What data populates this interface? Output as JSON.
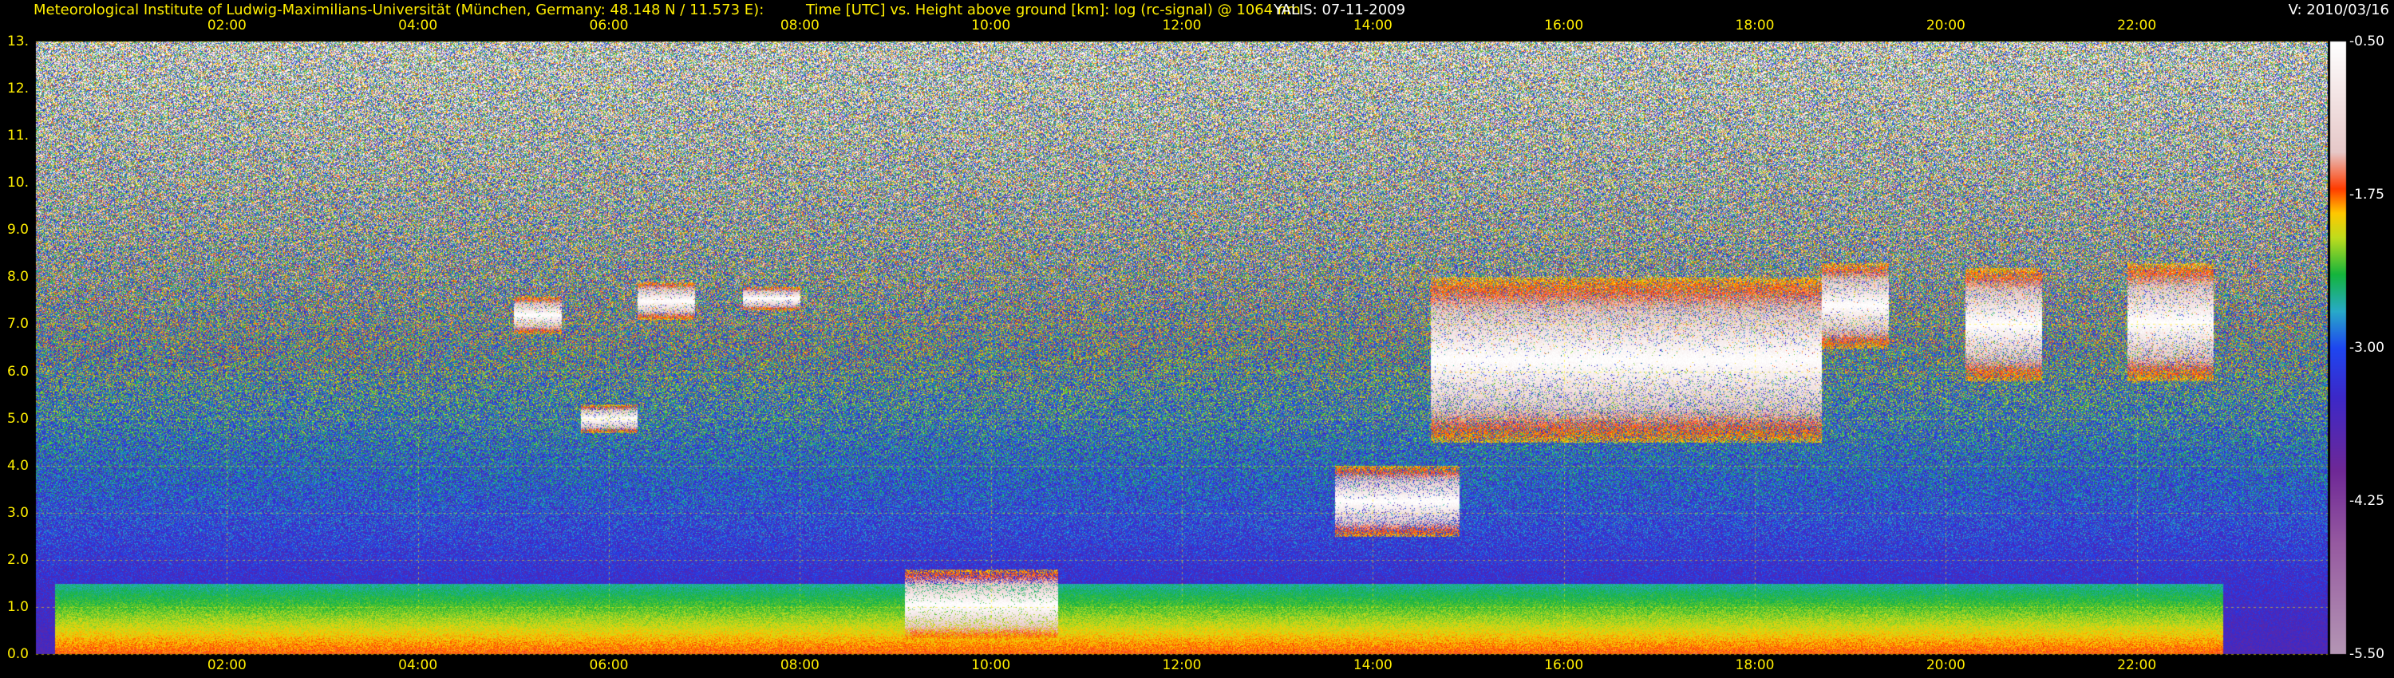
{
  "header": {
    "institute": "Meteorological Institute of Ludwig-Maximilians-Universität (München, Germany: 48.148 N / 11.573 E):",
    "axis_desc": "Time [UTC] vs. Height above ground [km]: log (rc-signal) @ 1064 nm",
    "instrument": "YALIS: 07-11-2009",
    "version": "V: 2010/03/16"
  },
  "colors": {
    "header_text": "#ffee00",
    "grid": "#ffee00",
    "background": "#000000"
  },
  "chart_data": {
    "type": "heatmap",
    "title": "Time [UTC] vs. Height above ground [km]: log (rc-signal) @ 1064 nm",
    "x_ticks": [
      "02:00",
      "04:00",
      "06:00",
      "08:00",
      "10:00",
      "12:00",
      "14:00",
      "16:00",
      "18:00",
      "20:00",
      "22:00"
    ],
    "x_tick_hours": [
      2,
      4,
      6,
      8,
      10,
      12,
      14,
      16,
      18,
      20,
      22
    ],
    "xlim_hours": [
      0.0,
      24.0
    ],
    "y_ticks": [
      "0.0",
      "1.0",
      "2.0",
      "3.0",
      "4.0",
      "5.0",
      "6.0",
      "7.0",
      "8.0",
      "9.0",
      "10.",
      "11.",
      "12.",
      "13."
    ],
    "y_tick_values": [
      0,
      1,
      2,
      3,
      4,
      5,
      6,
      7,
      8,
      9,
      10,
      11,
      12,
      13
    ],
    "ylim_km": [
      0,
      13
    ],
    "grid": true,
    "colorbar": {
      "labels": [
        "-0.50",
        "-1.75",
        "-3.00",
        "-4.25",
        "-5.50"
      ],
      "values": [
        -0.5,
        -1.75,
        -3.0,
        -4.25,
        -5.5
      ],
      "range": [
        -5.5,
        -0.5
      ]
    },
    "features": [
      {
        "kind": "boundary_layer",
        "start_h": 0.2,
        "end_h": 22.9,
        "top_km": 1.5
      },
      {
        "kind": "cloud",
        "start_h": 5.0,
        "end_h": 5.5,
        "base_km": 6.8,
        "top_km": 7.6
      },
      {
        "kind": "cloud",
        "start_h": 6.3,
        "end_h": 6.9,
        "base_km": 7.1,
        "top_km": 7.9
      },
      {
        "kind": "cloud",
        "start_h": 7.4,
        "end_h": 8.0,
        "base_km": 7.3,
        "top_km": 7.8
      },
      {
        "kind": "cloud",
        "start_h": 5.7,
        "end_h": 6.3,
        "base_km": 4.7,
        "top_km": 5.3
      },
      {
        "kind": "cloud",
        "start_h": 9.1,
        "end_h": 10.7,
        "base_km": 0.3,
        "top_km": 1.8
      },
      {
        "kind": "cloud",
        "start_h": 13.6,
        "end_h": 14.9,
        "base_km": 2.5,
        "top_km": 4.0
      },
      {
        "kind": "cloud",
        "start_h": 14.6,
        "end_h": 18.7,
        "base_km": 4.5,
        "top_km": 8.0
      },
      {
        "kind": "cloud",
        "start_h": 18.7,
        "end_h": 19.4,
        "base_km": 6.5,
        "top_km": 8.3
      },
      {
        "kind": "cloud",
        "start_h": 20.2,
        "end_h": 21.0,
        "base_km": 5.8,
        "top_km": 8.2
      },
      {
        "kind": "cloud",
        "start_h": 21.9,
        "end_h": 22.8,
        "base_km": 5.8,
        "top_km": 8.3
      }
    ]
  }
}
